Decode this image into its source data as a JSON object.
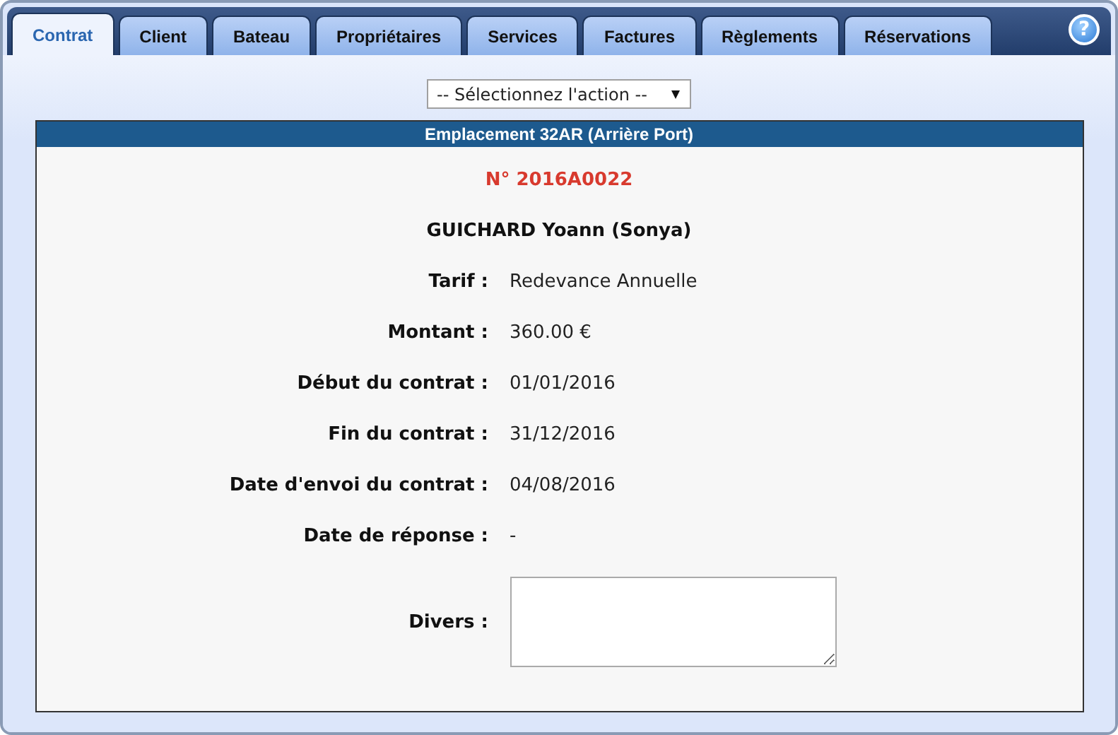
{
  "tabs": [
    {
      "label": "Contrat",
      "selected": true
    },
    {
      "label": "Client",
      "selected": false
    },
    {
      "label": "Bateau",
      "selected": false
    },
    {
      "label": "Propriétaires",
      "selected": false
    },
    {
      "label": "Services",
      "selected": false
    },
    {
      "label": "Factures",
      "selected": false
    },
    {
      "label": "Règlements",
      "selected": false
    },
    {
      "label": "Réservations",
      "selected": false
    }
  ],
  "help_button": "?",
  "action_select": {
    "value": "-- Sélectionnez l'action --"
  },
  "panel": {
    "title": "Emplacement 32AR (Arrière Port)",
    "contract_number": "N° 2016A0022",
    "client_name": "GUICHARD Yoann (Sonya)",
    "fields": [
      {
        "kind": "text",
        "label": "Tarif :",
        "value": "Redevance Annuelle"
      },
      {
        "kind": "text",
        "label": "Montant :",
        "value": "360.00 €"
      },
      {
        "kind": "text",
        "label": "Début du contrat :",
        "value": "01/01/2016"
      },
      {
        "kind": "text",
        "label": "Fin du contrat :",
        "value": "31/12/2016"
      },
      {
        "kind": "text",
        "label": "Date d'envoi du contrat :",
        "value": "04/08/2016"
      },
      {
        "kind": "text",
        "label": "Date de réponse :",
        "value": "-"
      },
      {
        "kind": "textarea",
        "label": "Divers :"
      }
    ]
  }
}
